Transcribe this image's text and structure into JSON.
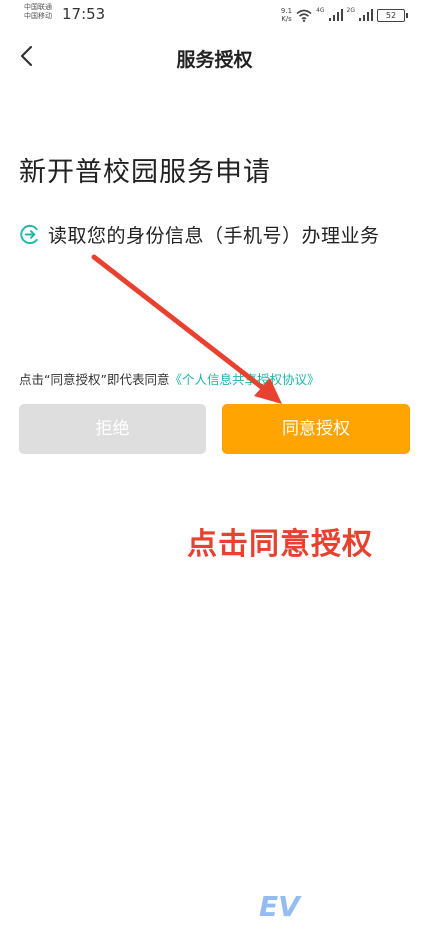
{
  "status_bar": {
    "carrier_1": "中国联通",
    "carrier_2": "中国移动",
    "time": "17:53",
    "net_speed_value": "9.1",
    "net_speed_unit": "K/s",
    "sig1_tag": "4G",
    "sig2_tag": "2G",
    "battery": "52"
  },
  "nav": {
    "title": "服务授权"
  },
  "main": {
    "heading": "新开普校园服务申请",
    "permission_text": "读取您的身份信息（手机号）办理业务",
    "agreement_prefix": "点击“同意授权”即代表同意",
    "agreement_link": "《个人信息共享授权协议》"
  },
  "buttons": {
    "reject": "拒绝",
    "agree": "同意授权"
  },
  "annotation": {
    "text": "点击同意授权"
  },
  "watermark": {
    "text": "EV"
  },
  "colors": {
    "accent_orange": "#ffa400",
    "link_teal": "#1cb8a8",
    "annotation_red": "#e8412f",
    "reject_gray": "#dedede"
  }
}
